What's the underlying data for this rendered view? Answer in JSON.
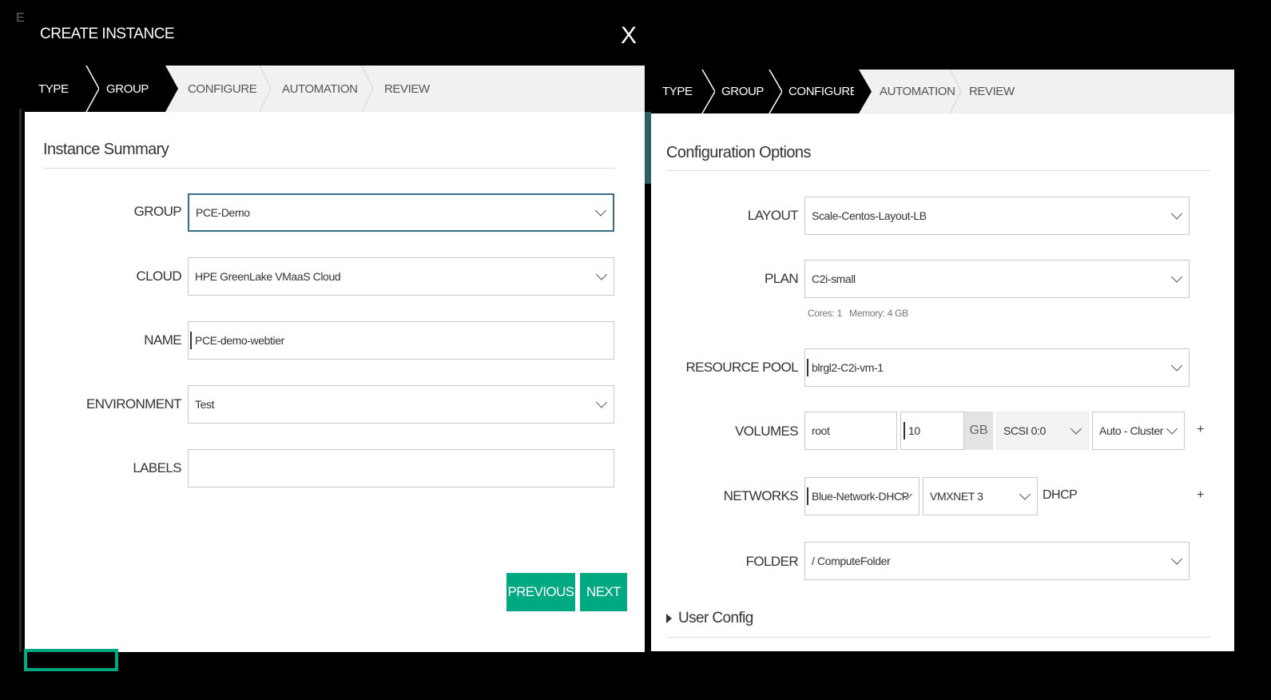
{
  "modal": {
    "title": "CREATE INSTANCE",
    "close": "X"
  },
  "left": {
    "steps": [
      "TYPE",
      "GROUP",
      "CONFIGURE",
      "AUTOMATION",
      "REVIEW"
    ],
    "section_title": "Instance Summary",
    "fields": {
      "group": {
        "label": "GROUP",
        "value": "PCE-Demo"
      },
      "cloud": {
        "label": "CLOUD",
        "value": "HPE GreenLake VMaaS Cloud"
      },
      "name": {
        "label": "NAME",
        "value": "PCE-demo-webtier"
      },
      "environment": {
        "label": "ENVIRONMENT",
        "value": "Test"
      },
      "labels": {
        "label": "LABELS",
        "value": ""
      }
    },
    "buttons": {
      "previous": "PREVIOUS",
      "next": "NEXT"
    }
  },
  "right": {
    "steps": [
      "TYPE",
      "GROUP",
      "CONFIGURE",
      "AUTOMATION",
      "REVIEW"
    ],
    "section_title": "Configuration Options",
    "fields": {
      "layout": {
        "label": "LAYOUT",
        "value": "Scale-Centos-Layout-LB"
      },
      "plan": {
        "label": "PLAN",
        "value": "C2i-small",
        "details": "Cores: 1   Memory: 4 GB"
      },
      "resource_pool": {
        "label": "RESOURCE POOL",
        "value": "blrgl2-C2i-vm-1"
      },
      "volumes": {
        "label": "VOLUMES",
        "name": "root",
        "size": "10",
        "unit": "GB",
        "controller": "SCSI 0:0",
        "datastore": "Auto - Cluster",
        "add": "+"
      },
      "networks": {
        "label": "NETWORKS",
        "network": "Blue-Network-DHCP",
        "adapter": "VMXNET 3",
        "ip_mode": "DHCP",
        "add": "+"
      },
      "folder": {
        "label": "FOLDER",
        "value": "/ ComputeFolder"
      }
    },
    "user_config": "User Config"
  },
  "colors": {
    "accent": "#01a982",
    "focus_border": "#3a6e86",
    "step_active_bg": "#000000"
  }
}
